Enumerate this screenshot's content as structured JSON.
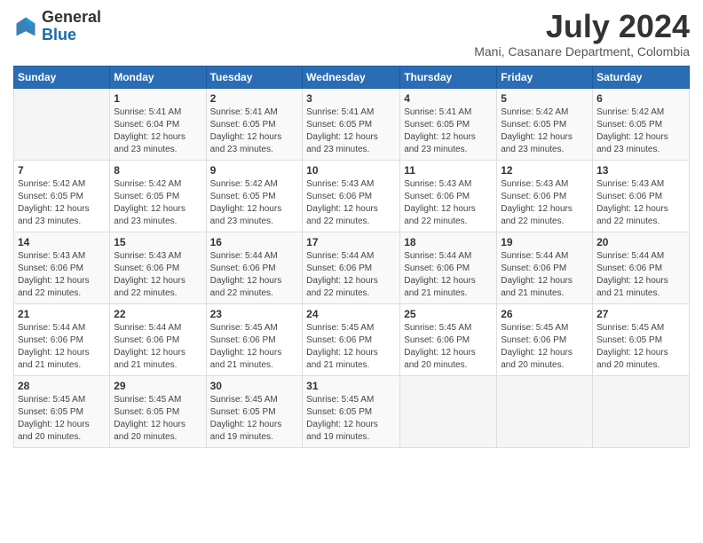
{
  "header": {
    "logo_general": "General",
    "logo_blue": "Blue",
    "month_year": "July 2024",
    "location": "Mani, Casanare Department, Colombia"
  },
  "weekdays": [
    "Sunday",
    "Monday",
    "Tuesday",
    "Wednesday",
    "Thursday",
    "Friday",
    "Saturday"
  ],
  "weeks": [
    [
      {
        "day": "",
        "info": ""
      },
      {
        "day": "1",
        "info": "Sunrise: 5:41 AM\nSunset: 6:04 PM\nDaylight: 12 hours\nand 23 minutes."
      },
      {
        "day": "2",
        "info": "Sunrise: 5:41 AM\nSunset: 6:05 PM\nDaylight: 12 hours\nand 23 minutes."
      },
      {
        "day": "3",
        "info": "Sunrise: 5:41 AM\nSunset: 6:05 PM\nDaylight: 12 hours\nand 23 minutes."
      },
      {
        "day": "4",
        "info": "Sunrise: 5:41 AM\nSunset: 6:05 PM\nDaylight: 12 hours\nand 23 minutes."
      },
      {
        "day": "5",
        "info": "Sunrise: 5:42 AM\nSunset: 6:05 PM\nDaylight: 12 hours\nand 23 minutes."
      },
      {
        "day": "6",
        "info": "Sunrise: 5:42 AM\nSunset: 6:05 PM\nDaylight: 12 hours\nand 23 minutes."
      }
    ],
    [
      {
        "day": "7",
        "info": "Sunrise: 5:42 AM\nSunset: 6:05 PM\nDaylight: 12 hours\nand 23 minutes."
      },
      {
        "day": "8",
        "info": "Sunrise: 5:42 AM\nSunset: 6:05 PM\nDaylight: 12 hours\nand 23 minutes."
      },
      {
        "day": "9",
        "info": "Sunrise: 5:42 AM\nSunset: 6:05 PM\nDaylight: 12 hours\nand 23 minutes."
      },
      {
        "day": "10",
        "info": "Sunrise: 5:43 AM\nSunset: 6:06 PM\nDaylight: 12 hours\nand 22 minutes."
      },
      {
        "day": "11",
        "info": "Sunrise: 5:43 AM\nSunset: 6:06 PM\nDaylight: 12 hours\nand 22 minutes."
      },
      {
        "day": "12",
        "info": "Sunrise: 5:43 AM\nSunset: 6:06 PM\nDaylight: 12 hours\nand 22 minutes."
      },
      {
        "day": "13",
        "info": "Sunrise: 5:43 AM\nSunset: 6:06 PM\nDaylight: 12 hours\nand 22 minutes."
      }
    ],
    [
      {
        "day": "14",
        "info": "Sunrise: 5:43 AM\nSunset: 6:06 PM\nDaylight: 12 hours\nand 22 minutes."
      },
      {
        "day": "15",
        "info": "Sunrise: 5:43 AM\nSunset: 6:06 PM\nDaylight: 12 hours\nand 22 minutes."
      },
      {
        "day": "16",
        "info": "Sunrise: 5:44 AM\nSunset: 6:06 PM\nDaylight: 12 hours\nand 22 minutes."
      },
      {
        "day": "17",
        "info": "Sunrise: 5:44 AM\nSunset: 6:06 PM\nDaylight: 12 hours\nand 22 minutes."
      },
      {
        "day": "18",
        "info": "Sunrise: 5:44 AM\nSunset: 6:06 PM\nDaylight: 12 hours\nand 21 minutes."
      },
      {
        "day": "19",
        "info": "Sunrise: 5:44 AM\nSunset: 6:06 PM\nDaylight: 12 hours\nand 21 minutes."
      },
      {
        "day": "20",
        "info": "Sunrise: 5:44 AM\nSunset: 6:06 PM\nDaylight: 12 hours\nand 21 minutes."
      }
    ],
    [
      {
        "day": "21",
        "info": "Sunrise: 5:44 AM\nSunset: 6:06 PM\nDaylight: 12 hours\nand 21 minutes."
      },
      {
        "day": "22",
        "info": "Sunrise: 5:44 AM\nSunset: 6:06 PM\nDaylight: 12 hours\nand 21 minutes."
      },
      {
        "day": "23",
        "info": "Sunrise: 5:45 AM\nSunset: 6:06 PM\nDaylight: 12 hours\nand 21 minutes."
      },
      {
        "day": "24",
        "info": "Sunrise: 5:45 AM\nSunset: 6:06 PM\nDaylight: 12 hours\nand 21 minutes."
      },
      {
        "day": "25",
        "info": "Sunrise: 5:45 AM\nSunset: 6:06 PM\nDaylight: 12 hours\nand 20 minutes."
      },
      {
        "day": "26",
        "info": "Sunrise: 5:45 AM\nSunset: 6:06 PM\nDaylight: 12 hours\nand 20 minutes."
      },
      {
        "day": "27",
        "info": "Sunrise: 5:45 AM\nSunset: 6:05 PM\nDaylight: 12 hours\nand 20 minutes."
      }
    ],
    [
      {
        "day": "28",
        "info": "Sunrise: 5:45 AM\nSunset: 6:05 PM\nDaylight: 12 hours\nand 20 minutes."
      },
      {
        "day": "29",
        "info": "Sunrise: 5:45 AM\nSunset: 6:05 PM\nDaylight: 12 hours\nand 20 minutes."
      },
      {
        "day": "30",
        "info": "Sunrise: 5:45 AM\nSunset: 6:05 PM\nDaylight: 12 hours\nand 19 minutes."
      },
      {
        "day": "31",
        "info": "Sunrise: 5:45 AM\nSunset: 6:05 PM\nDaylight: 12 hours\nand 19 minutes."
      },
      {
        "day": "",
        "info": ""
      },
      {
        "day": "",
        "info": ""
      },
      {
        "day": "",
        "info": ""
      }
    ]
  ]
}
